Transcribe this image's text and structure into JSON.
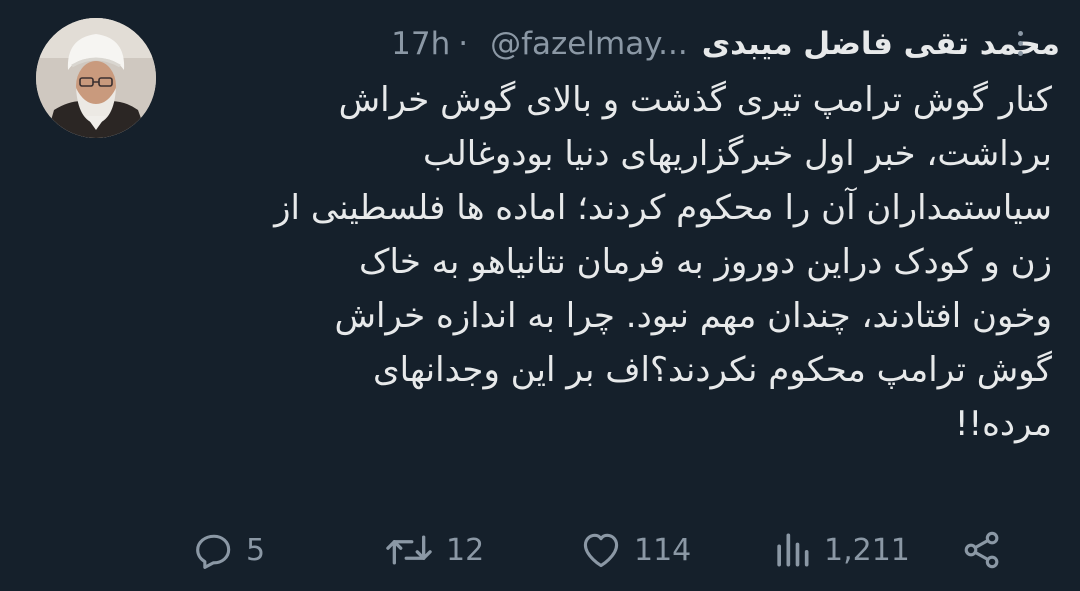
{
  "user": {
    "display_name": "محمد تقی فاضل میبدی",
    "handle": "@fazelmay...",
    "separator": "·",
    "time": "17h"
  },
  "tweet": {
    "lines": [
      "کنار گوش ترامپ تیری گذشت و بالای گوش خراش",
      "برداشت، خبر اول خبرگزاریهای دنیا بودوغالب",
      "سیاستمداران آن را محکوم کردند؛ اماده ها فلسطینی از",
      "زن و کودک دراین دوروز به فرمان نتانیاهو به خاک",
      "وخون افتادند، چندان مهم نبود. چرا به اندازه خراش",
      "گوش ترامپ محکوم نکردند؟اف بر این وجدانهای",
      "مرده!!"
    ]
  },
  "actions": {
    "reply": {
      "icon": "reply-icon",
      "count": "5"
    },
    "retweet": {
      "icon": "retweet-icon",
      "count": "12"
    },
    "like": {
      "icon": "heart-icon",
      "count": "114"
    },
    "views": {
      "icon": "views-icon",
      "count": "1,211"
    },
    "share": {
      "icon": "share-icon"
    }
  },
  "colors": {
    "background": "#15202b",
    "text": "#e7e9ea",
    "muted": "#8b98a5"
  }
}
